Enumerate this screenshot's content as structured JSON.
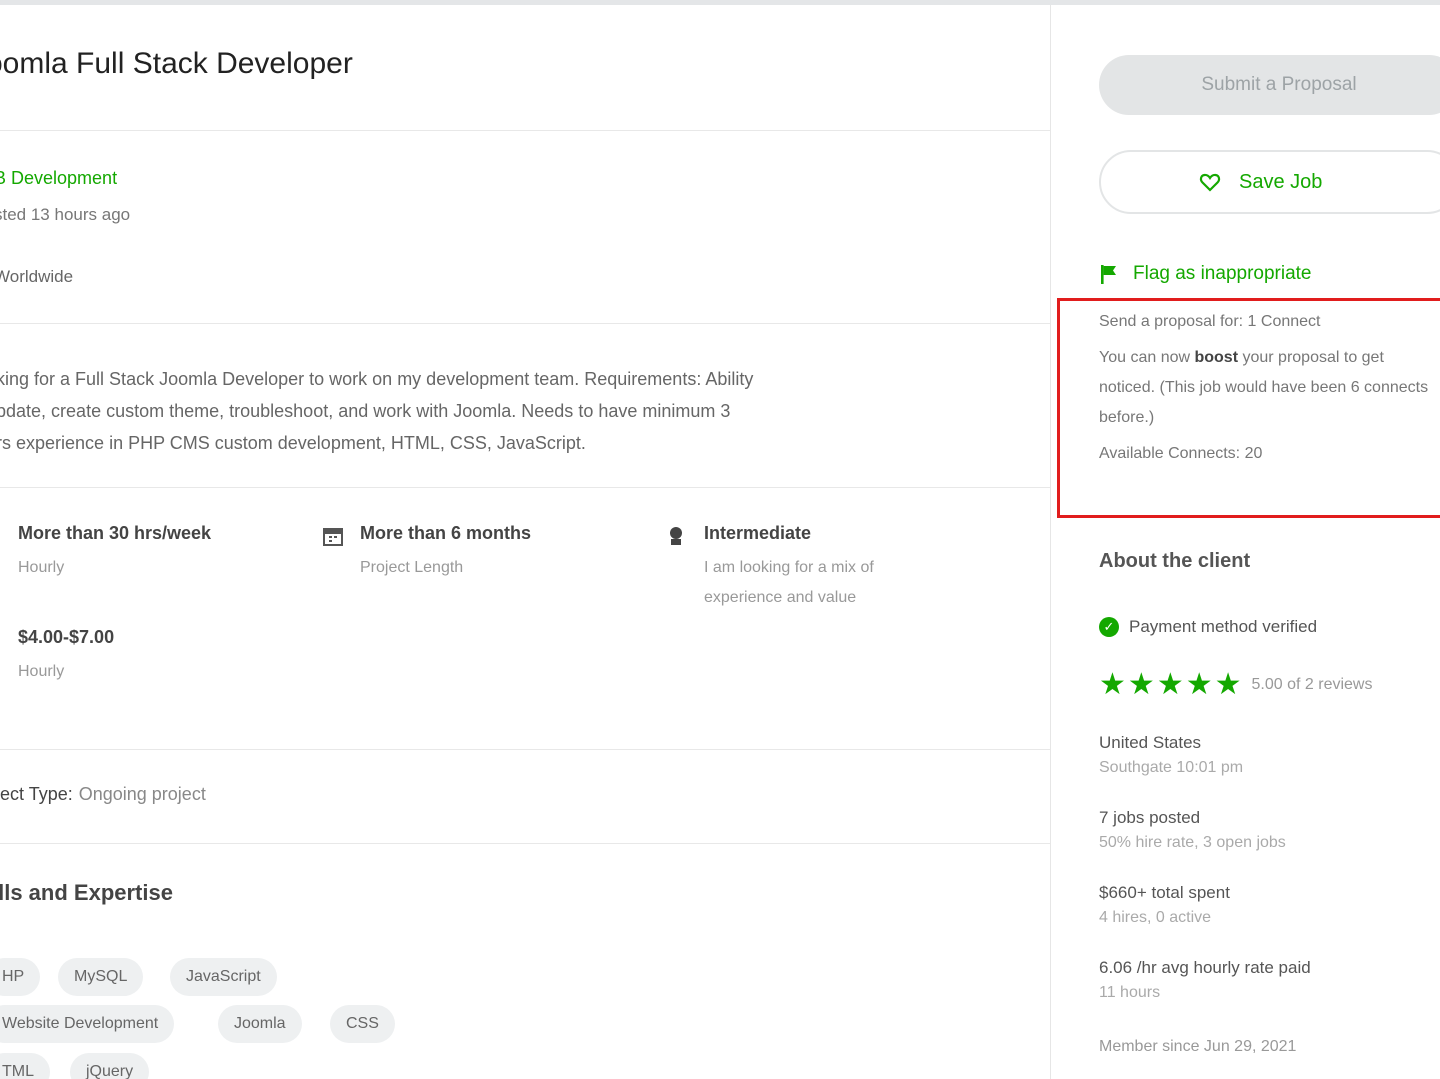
{
  "job": {
    "title": "oomla Full Stack Developer",
    "category": "B Development",
    "posted": "sted 13 hours ago",
    "location": "Worldwide",
    "description": [
      "oking for a Full Stack Joomla Developer to work on my development team. Requirements: Ability",
      "update, create custom theme, troubleshoot, and work with Joomla. Needs to have minimum 3",
      "ars experience in PHP CMS custom development, HTML, CSS, JavaScript."
    ],
    "features": {
      "hours": {
        "title": "More than 30 hrs/week",
        "sub": "Hourly",
        "icon": "clock-icon"
      },
      "length": {
        "title": "More than 6 months",
        "sub": "Project Length",
        "icon": "calendar-icon"
      },
      "level": {
        "title": "Intermediate",
        "sub1": "I am looking for a mix of",
        "sub2": "experience and value",
        "icon": "experience-level-icon"
      },
      "rate": {
        "title": "$4.00-$7.00",
        "sub": "Hourly",
        "icon": "rate-icon"
      }
    },
    "project_type_label": "oject Type:",
    "project_type_value": "Ongoing project",
    "skills_title": "ills and Expertise",
    "skills": [
      "HP",
      "MySQL",
      "JavaScript",
      "Website Development",
      "Joomla",
      "CSS",
      "TML",
      "jQuery"
    ]
  },
  "sidebar": {
    "submit_label": "Submit a Proposal",
    "save_label": "Save Job",
    "flag_label": "Flag as inappropriate",
    "connects": {
      "send_text": "Send a proposal for: 1 Connect",
      "boost_prefix": "You can now ",
      "boost_bold": "boost",
      "boost_suffix": " your proposal to get noticed. (This job would have been 6 connects before.)",
      "available": "Available Connects: 20"
    },
    "client": {
      "title": "About the client",
      "payment": "Payment method verified",
      "rating": 5,
      "rating_text": "5.00 of 2 reviews",
      "country": "United States",
      "city_time": "Southgate 10:01 pm",
      "jobs_posted": "7 jobs posted",
      "hire_rate": "50% hire rate, 3 open jobs",
      "total_spent": "$660+ total spent",
      "hires": "4 hires, 0 active",
      "avg_rate": "6.06 /hr avg hourly rate paid",
      "hours": "11 hours",
      "member_since": "Member since Jun 29, 2021"
    }
  },
  "colors": {
    "accent": "#14a800",
    "highlight_border": "#e11d1d",
    "chip_bg": "#eef0f1"
  }
}
